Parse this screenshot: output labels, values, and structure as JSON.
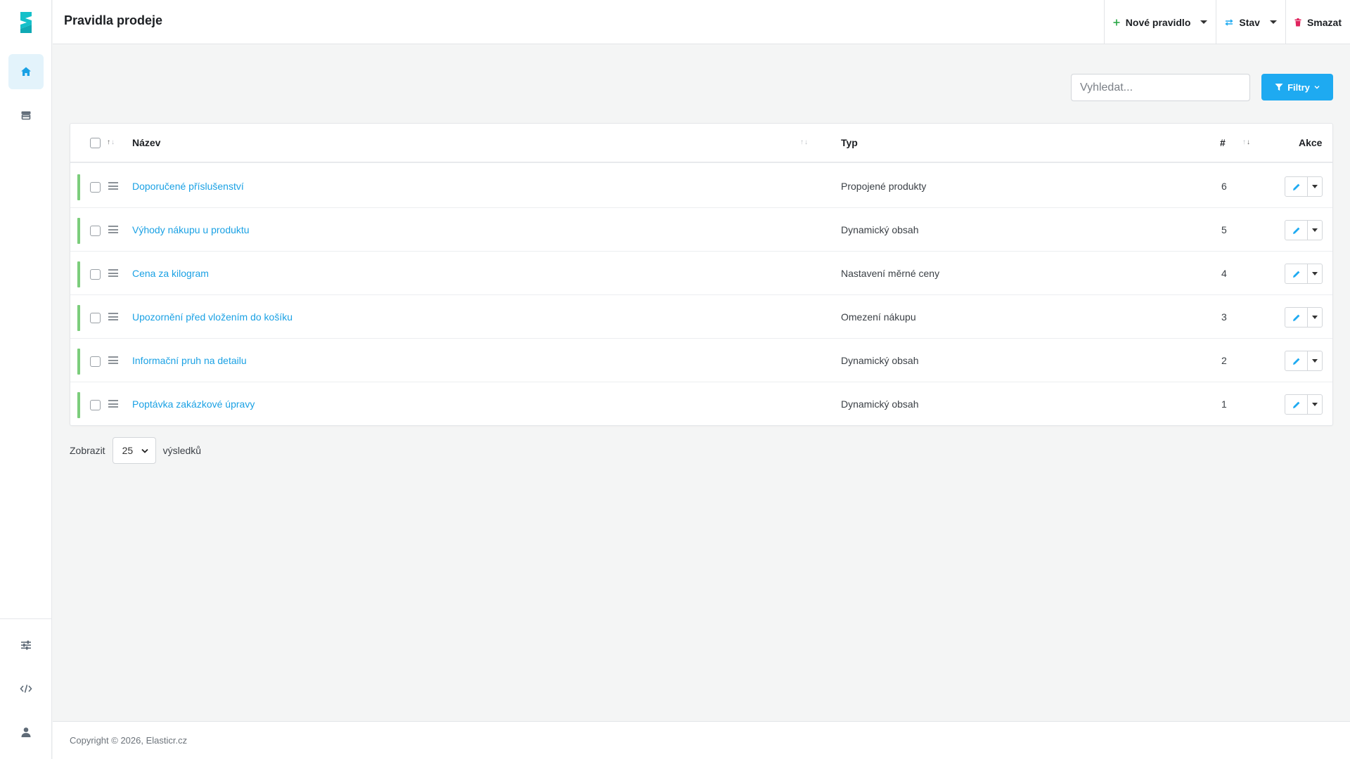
{
  "app": {
    "page_title": "Pravidla prodeje",
    "accent_color": "#1eaaf1",
    "status_color": "#7ccd7c"
  },
  "sidebar": {
    "top_items": [
      {
        "icon": "home-icon",
        "active": true
      },
      {
        "icon": "store-icon",
        "active": false
      }
    ],
    "bottom_items": [
      {
        "icon": "sliders-icon"
      },
      {
        "icon": "code-icon"
      },
      {
        "icon": "user-icon"
      }
    ]
  },
  "header": {
    "actions": [
      {
        "label": "Nové pravidlo",
        "icon": "plus-icon",
        "icon_color": "#28a745",
        "dropdown": true
      },
      {
        "label": "Stav",
        "icon": "swap-icon",
        "icon_color": "#1eaaf1",
        "dropdown": true
      },
      {
        "label": "Smazat",
        "icon": "trash-icon",
        "icon_color": "#e0245e",
        "dropdown": false
      }
    ]
  },
  "toolbar": {
    "search_placeholder": "Vyhledat...",
    "filter_label": "Filtry"
  },
  "table": {
    "columns": {
      "name": "Název",
      "type": "Typ",
      "count": "#",
      "actions": "Akce"
    },
    "rows": [
      {
        "name": "Doporučené příslušenství",
        "type": "Propojené produkty",
        "num": "6"
      },
      {
        "name": "Výhody nákupu u produktu",
        "type": "Dynamický obsah",
        "num": "5"
      },
      {
        "name": "Cena za kilogram",
        "type": "Nastavení měrné ceny",
        "num": "4"
      },
      {
        "name": "Upozornění před vložením do košíku",
        "type": "Omezení nákupu",
        "num": "3"
      },
      {
        "name": "Informační pruh na detailu",
        "type": "Dynamický obsah",
        "num": "2"
      },
      {
        "name": "Poptávka zakázkové úpravy",
        "type": "Dynamický obsah",
        "num": "1"
      }
    ]
  },
  "pager": {
    "show_label": "Zobrazit",
    "page_size": "25",
    "results_label": "výsledků"
  },
  "footer": {
    "copyright": "Copyright © 2026, Elasticr.cz"
  }
}
